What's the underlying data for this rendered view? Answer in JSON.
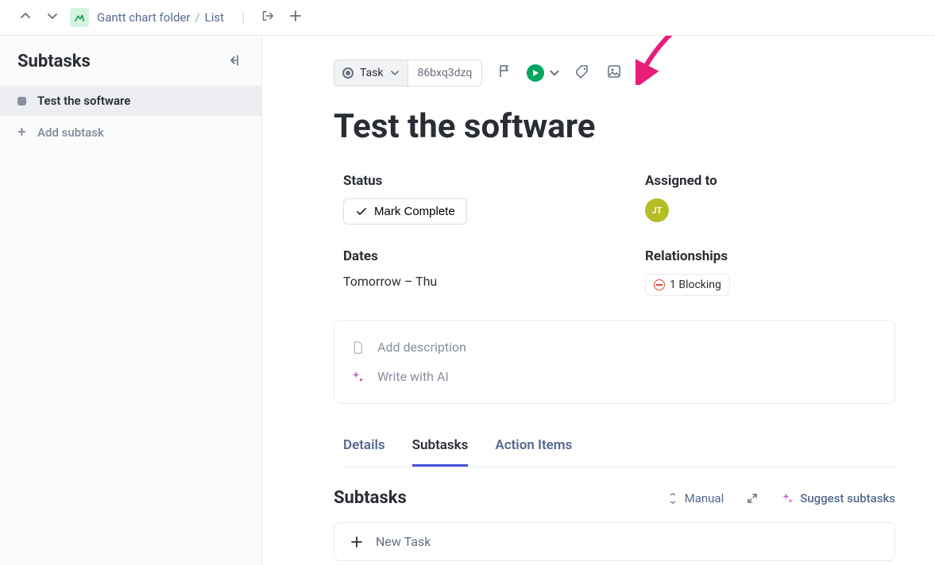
{
  "breadcrumb": {
    "folder": "Gantt chart folder",
    "current": "List"
  },
  "sidebar": {
    "title": "Subtasks",
    "items": [
      {
        "label": "Test the software"
      }
    ],
    "add_label": "Add subtask"
  },
  "task": {
    "type_label": "Task",
    "id": "86bxq3dzq",
    "title": "Test the software",
    "fields": {
      "status_label": "Status",
      "mark_complete": "Mark Complete",
      "assigned_label": "Assigned to",
      "assignee_initials": "JT",
      "dates_label": "Dates",
      "dates_value": "Tomorrow – Thu",
      "relationships_label": "Relationships",
      "blocking_text": "1 Blocking"
    },
    "description": {
      "add_text": "Add description",
      "ai_text": "Write with AI"
    },
    "tabs": {
      "details": "Details",
      "subtasks": "Subtasks",
      "action_items": "Action Items"
    },
    "subtasks_section": {
      "title": "Subtasks",
      "sort_label": "Manual",
      "suggest_label": "Suggest subtasks",
      "new_task_label": "New Task"
    }
  }
}
